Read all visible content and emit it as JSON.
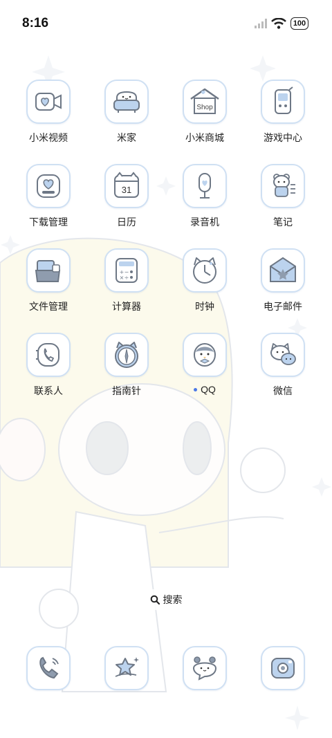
{
  "status_bar": {
    "time": "8:16",
    "battery": "100",
    "icons": [
      "signal-icon",
      "wifi-icon",
      "battery-icon"
    ]
  },
  "apps": [
    {
      "label": "小米视频",
      "icon": "video-camera-icon",
      "notification_dot": false
    },
    {
      "label": "米家",
      "icon": "sofa-icon",
      "notification_dot": false
    },
    {
      "label": "小米商城",
      "icon": "shop-icon",
      "notification_dot": false
    },
    {
      "label": "游戏中心",
      "icon": "game-phone-icon",
      "notification_dot": false
    },
    {
      "label": "下载管理",
      "icon": "download-heart-icon",
      "notification_dot": false
    },
    {
      "label": "日历",
      "icon": "calendar-icon",
      "notification_dot": false
    },
    {
      "label": "录音机",
      "icon": "microphone-icon",
      "notification_dot": false
    },
    {
      "label": "笔记",
      "icon": "bear-notes-icon",
      "notification_dot": false
    },
    {
      "label": "文件管理",
      "icon": "folder-icon",
      "notification_dot": false
    },
    {
      "label": "计算器",
      "icon": "calculator-icon",
      "notification_dot": false
    },
    {
      "label": "时钟",
      "icon": "cat-clock-icon",
      "notification_dot": false
    },
    {
      "label": "电子邮件",
      "icon": "envelope-icon",
      "notification_dot": false
    },
    {
      "label": "联系人",
      "icon": "phone-contact-icon",
      "notification_dot": false
    },
    {
      "label": "指南针",
      "icon": "compass-icon",
      "notification_dot": false
    },
    {
      "label": "QQ",
      "icon": "penguin-icon",
      "notification_dot": true
    },
    {
      "label": "微信",
      "icon": "chat-cat-icon",
      "notification_dot": false
    }
  ],
  "calendar_day": "31",
  "shop_text": "Shop",
  "search": {
    "label": "搜索",
    "icon": "search-icon"
  },
  "dock": [
    {
      "icon": "phone-icon"
    },
    {
      "icon": "star-icon"
    },
    {
      "icon": "bear-message-icon"
    },
    {
      "icon": "camera-icon"
    }
  ],
  "colors": {
    "accent": "#4b78e6",
    "icon_border": "#cfe0f3",
    "icon_fill": "#bcd3ee"
  }
}
